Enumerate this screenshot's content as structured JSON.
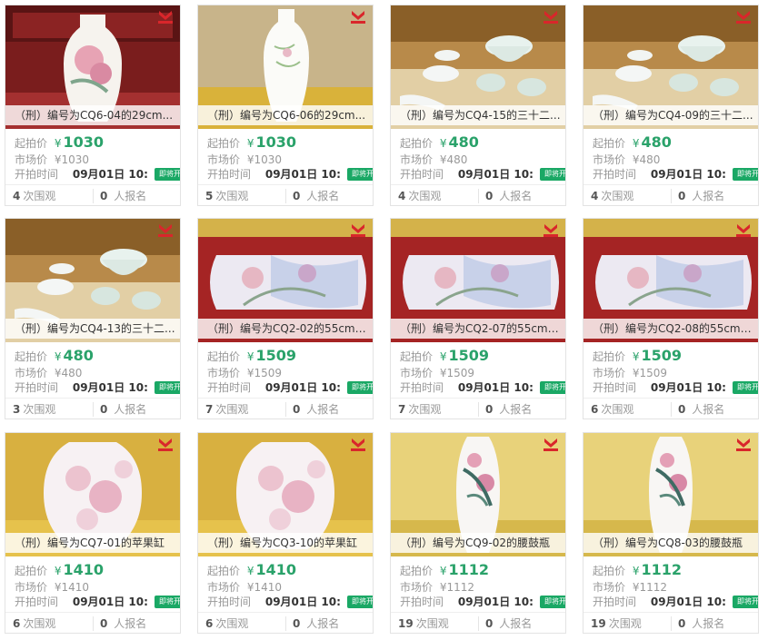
{
  "labels": {
    "start_price": "起拍价",
    "market_price": "市场价",
    "start_time": "开拍时间",
    "badge": "即将开始",
    "views_suffix": "次围观",
    "signup_suffix": "人报名",
    "currency": "¥"
  },
  "colors": {
    "accent_green": "#2aa26a",
    "badge_green": "#1aa865"
  },
  "items": [
    {
      "title": "（刑）编号为CQ6-04的29cm...",
      "price": "1030",
      "market": "¥1030",
      "time": "09月01日 10:",
      "views": "4",
      "signups": "0",
      "image": "pink-peony-vase-in-red-box"
    },
    {
      "title": "（刑）编号为CQ6-06的29cm...",
      "price": "1030",
      "market": "¥1030",
      "time": "09月01日 10:",
      "views": "5",
      "signups": "0",
      "image": "white-floral-vase-on-gold-box"
    },
    {
      "title": "（刑）编号为CQ4-15的三十二...",
      "price": "480",
      "market": "¥480",
      "time": "09月01日 10:",
      "views": "4",
      "signups": "0",
      "image": "celadon-tea-set"
    },
    {
      "title": "（刑）编号为CQ4-09的三十二...",
      "price": "480",
      "market": "¥480",
      "time": "09月01日 10:",
      "views": "4",
      "signups": "0",
      "image": "celadon-tea-set"
    },
    {
      "title": "（刑）编号为CQ4-13的三十二...",
      "price": "480",
      "market": "¥480",
      "time": "09月01日 10:",
      "views": "3",
      "signups": "0",
      "image": "celadon-tea-set"
    },
    {
      "title": "（刑）编号为CQ2-02的55cm粉...",
      "price": "1509",
      "market": "¥1509",
      "time": "09月01日 10:",
      "views": "7",
      "signups": "0",
      "image": "large-lotus-vase-lying"
    },
    {
      "title": "（刑）编号为CQ2-07的55cm粉...",
      "price": "1509",
      "market": "¥1509",
      "time": "09月01日 10:",
      "views": "7",
      "signups": "0",
      "image": "large-lotus-vase-lying"
    },
    {
      "title": "（刑）编号为CQ2-08的55cm粉...",
      "price": "1509",
      "market": "¥1509",
      "time": "09月01日 10:",
      "views": "6",
      "signups": "0",
      "image": "large-lotus-vase-lying"
    },
    {
      "title": "（刑）编号为CQ7-01的苹果缸",
      "price": "1410",
      "market": "¥1410",
      "time": "09月01日 10:",
      "views": "6",
      "signups": "0",
      "image": "pink-floral-jar"
    },
    {
      "title": "（刑）编号为CQ3-10的苹果缸",
      "price": "1410",
      "market": "¥1410",
      "time": "09月01日 10:",
      "views": "6",
      "signups": "0",
      "image": "pink-floral-jar"
    },
    {
      "title": "（刑）编号为CQ9-02的腰鼓瓶",
      "price": "1112",
      "market": "¥1112",
      "time": "09月01日 10:",
      "views": "19",
      "signups": "0",
      "image": "tall-peony-vase"
    },
    {
      "title": "（刑）编号为CQ8-03的腰鼓瓶",
      "price": "1112",
      "market": "¥1112",
      "time": "09月01日 10:",
      "views": "19",
      "signups": "0",
      "image": "tall-peony-vase"
    }
  ]
}
